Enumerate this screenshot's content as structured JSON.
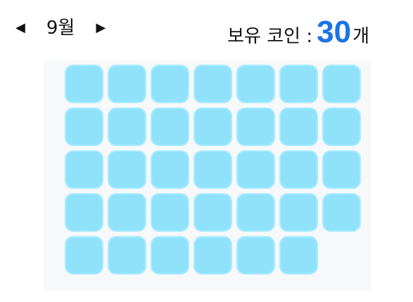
{
  "header": {
    "prev_month_icon": "triangle-left-icon",
    "next_month_icon": "triangle-right-icon",
    "prev_glyph": "◀",
    "next_glyph": "▶",
    "month_label": "9월"
  },
  "coins": {
    "label": "보유 코인 :",
    "value": "30",
    "unit": "개"
  },
  "calendar": {
    "day_count": 34,
    "cell_color": "#90e2fb",
    "panel_color": "#f6f8fa"
  },
  "colors": {
    "accent": "#1a73e8"
  }
}
